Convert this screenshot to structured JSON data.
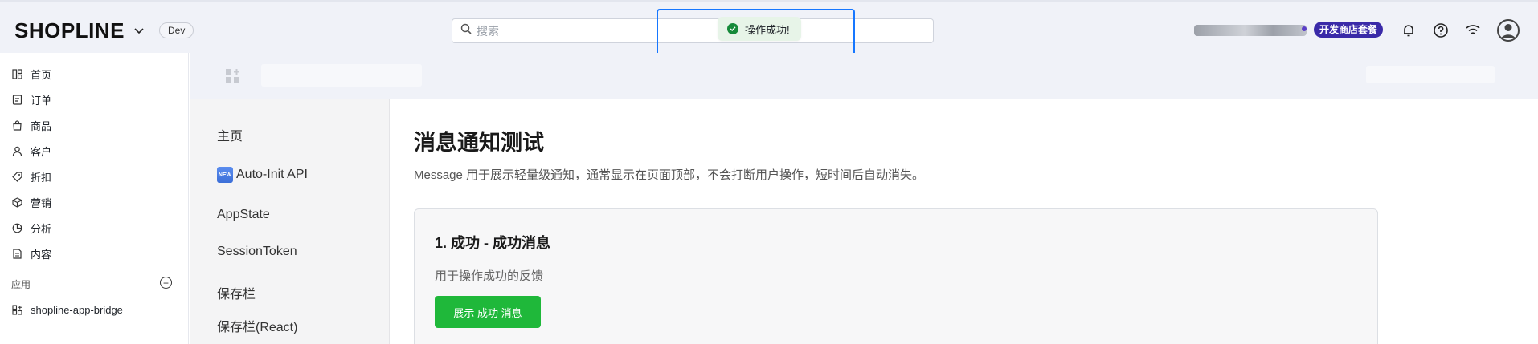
{
  "header": {
    "logo_text": "SHOPLINE",
    "env_badge": "Dev",
    "search_placeholder": "搜索",
    "plan_badge": "开发商店套餐",
    "icons": [
      "chevron-down-icon",
      "search-icon",
      "bell-icon",
      "help-icon",
      "wifi-icon",
      "user-avatar-icon"
    ]
  },
  "toast": {
    "message": "操作成功!",
    "status_color": "#168a3a"
  },
  "sidebar": {
    "items": [
      {
        "label": "首页",
        "icon": "home-icon"
      },
      {
        "label": "订单",
        "icon": "orders-icon"
      },
      {
        "label": "商品",
        "icon": "bag-icon"
      },
      {
        "label": "客户",
        "icon": "person-icon"
      },
      {
        "label": "折扣",
        "icon": "tag-icon"
      },
      {
        "label": "营销",
        "icon": "cube-icon"
      },
      {
        "label": "分析",
        "icon": "pie-icon"
      },
      {
        "label": "内容",
        "icon": "document-icon"
      }
    ],
    "apps_label": "应用",
    "app_item": "shopline-app-bridge"
  },
  "app_nav": {
    "items": [
      "主页",
      "Auto-Init API",
      "AppState",
      "SessionToken",
      "保存栏",
      "保存栏(React)"
    ]
  },
  "main": {
    "title": "消息通知测试",
    "description": "Message 用于展示轻量级通知，通常显示在页面顶部，不会打断用户操作，短时间后自动消失。",
    "card": {
      "title": "1. 成功 - 成功消息",
      "description": "用于操作成功的反馈",
      "button_label": "展示 成功 消息",
      "button_color": "#1fb83a"
    }
  }
}
